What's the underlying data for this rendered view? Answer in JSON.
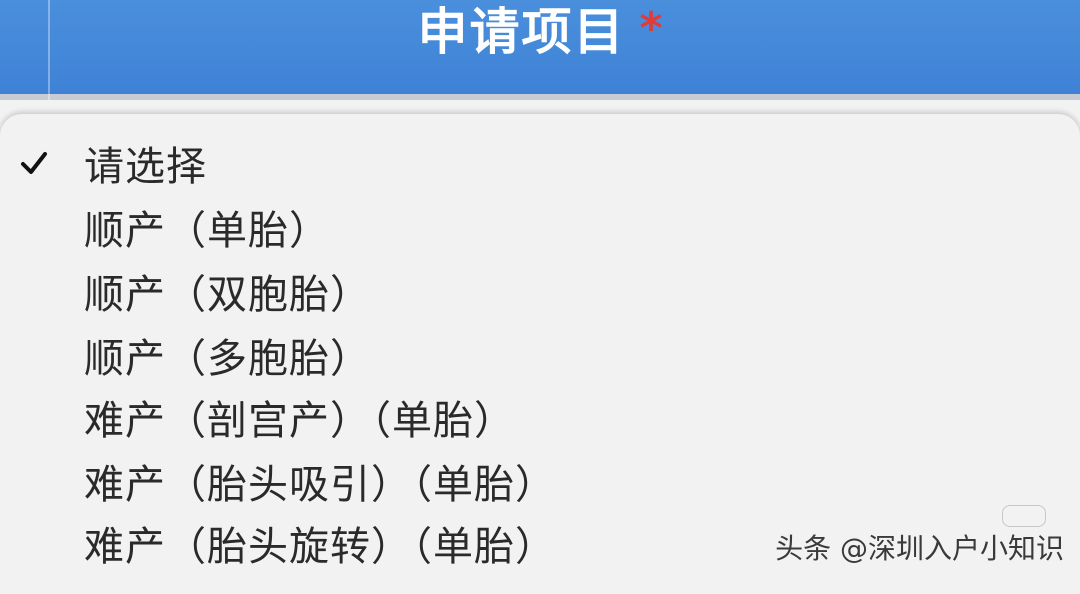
{
  "header": {
    "title": "申请项目",
    "required_mark": "*",
    "color": "#4187d8"
  },
  "dropdown": {
    "selected_index": 0,
    "options": [
      {
        "label": "请选择",
        "selected": true
      },
      {
        "label": "顺产（单胎）",
        "selected": false
      },
      {
        "label": "顺产（双胞胎）",
        "selected": false
      },
      {
        "label": "顺产（多胞胎）",
        "selected": false
      },
      {
        "label": "难产（剖宫产）（单胎）",
        "selected": false
      },
      {
        "label": "难产（胎头吸引）（单胎）",
        "selected": false
      },
      {
        "label": "难产（胎头旋转）（单胎）",
        "selected": false
      }
    ],
    "check_icon": "checkmark-icon"
  },
  "watermark": {
    "text": "头条 @深圳入户小知识"
  }
}
